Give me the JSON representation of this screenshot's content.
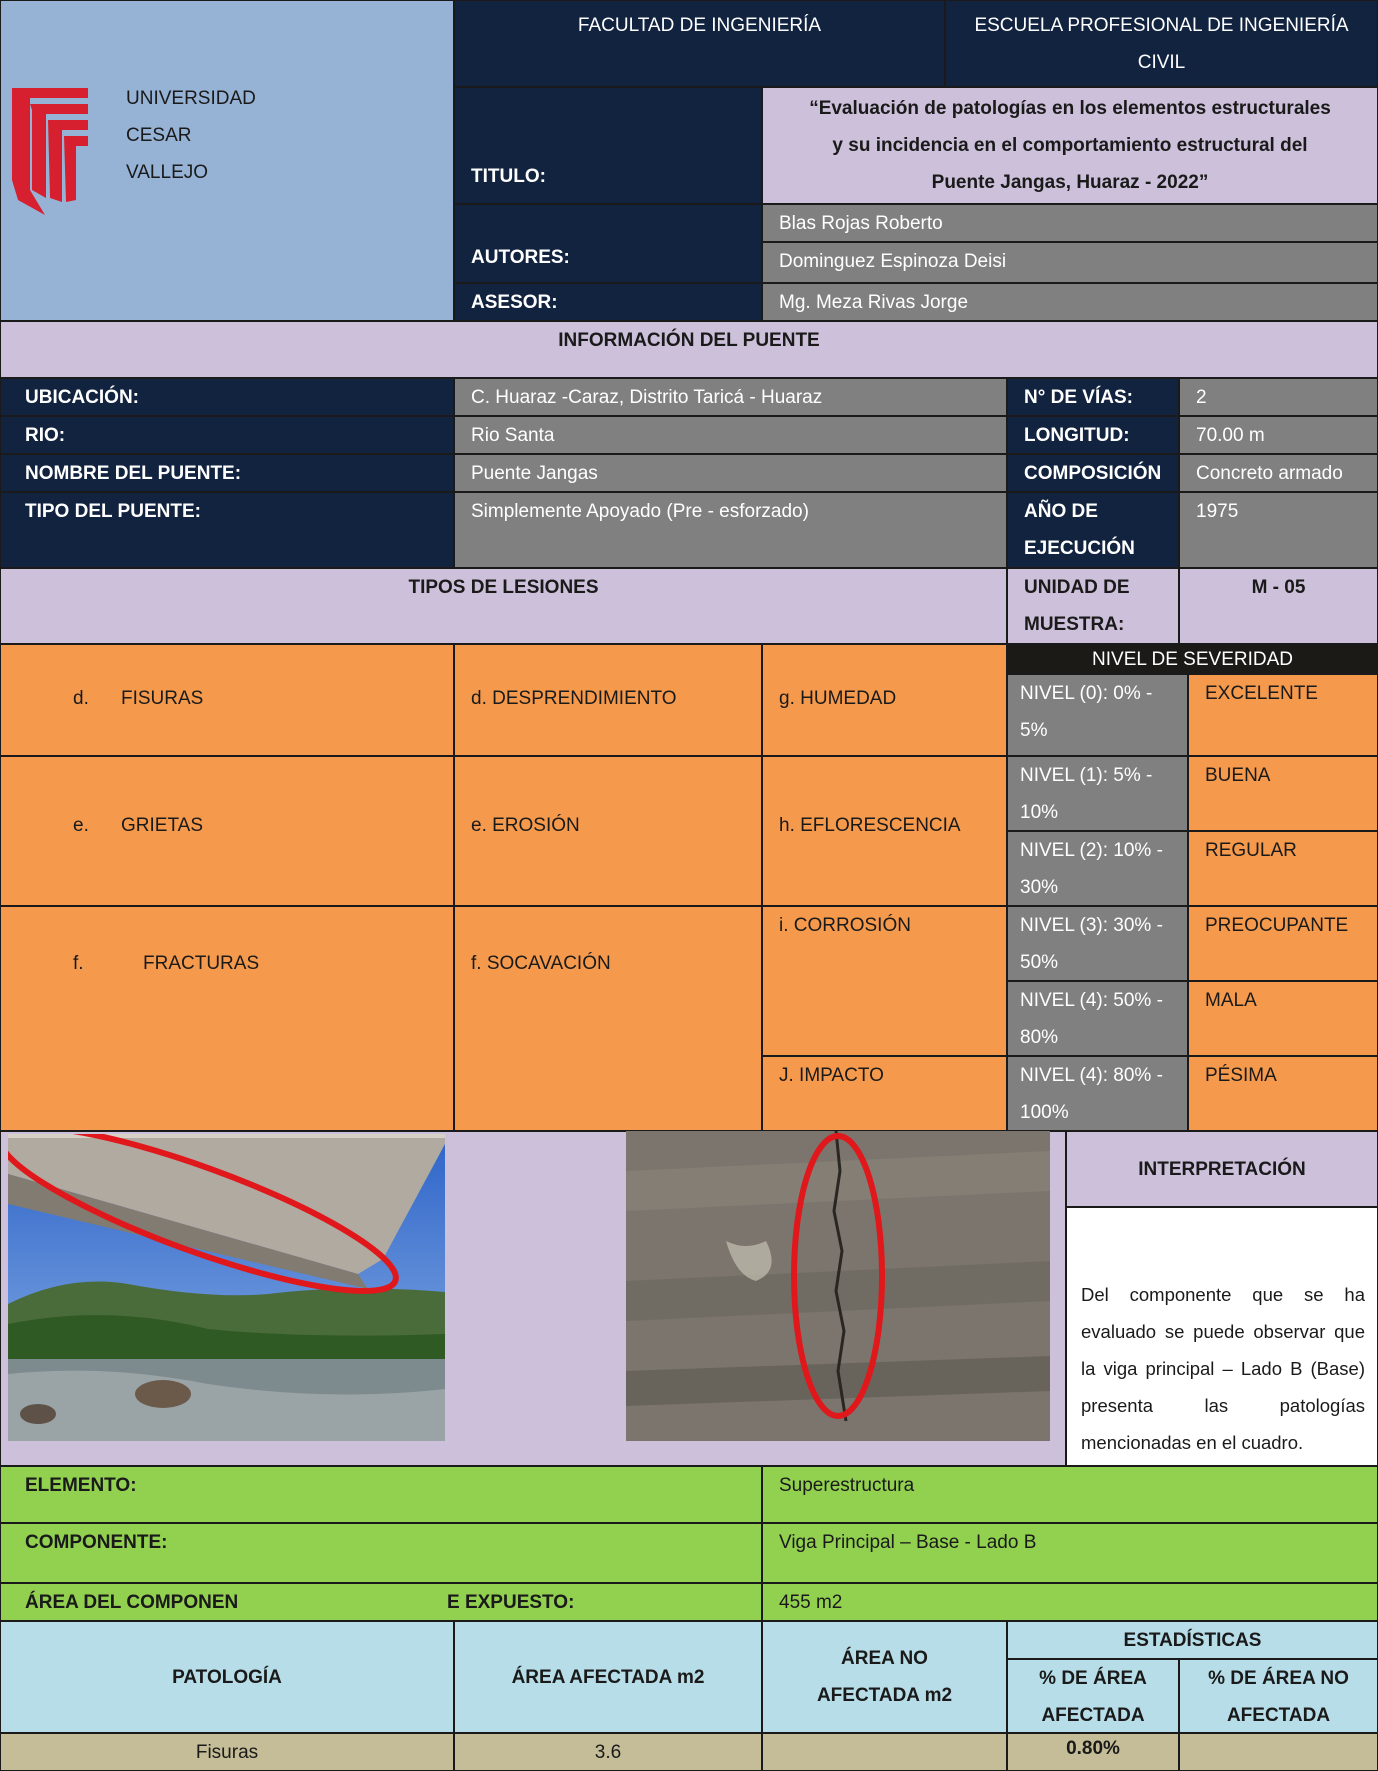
{
  "header": {
    "university": [
      "UNIVERSIDAD",
      "CESAR",
      "VALLEJO"
    ],
    "faculty": "FACULTAD DE INGENIERÍA",
    "school": "ESCUELA PROFESIONAL DE INGENIERÍA CIVIL",
    "title_label": "TITULO:",
    "title_lines": [
      "“Evaluación de patologías en los elementos estructurales",
      "y su incidencia en el comportamiento estructural del",
      "Puente Jangas, Huaraz - 2022”"
    ],
    "authors_label": "AUTORES:",
    "authors": [
      "Blas Rojas Roberto",
      "Dominguez Espinoza Deisi"
    ],
    "advisor_label": "ASESOR:",
    "advisor": "Mg. Meza Rivas Jorge"
  },
  "bridge_info": {
    "heading": "INFORMACIÓN DEL PUENTE",
    "location_label": "UBICACIÓN:",
    "location": "C. Huaraz -Caraz, Distrito Taricá - Huaraz",
    "lanes_label": "N° DE VÍAS:",
    "lanes": "2",
    "river_label": "RIO:",
    "river": "Rio Santa",
    "length_label": "LONGITUD:",
    "length": "70.00 m",
    "name_label": "NOMBRE DEL PUENTE:",
    "name": "Puente Jangas",
    "composition_label": "COMPOSICIÓN",
    "composition": "Concreto armado",
    "type_label": "TIPO DEL PUENTE:",
    "type": "Simplemente Apoyado (Pre - esforzado)",
    "year_label_1": "AÑO DE",
    "year_label_2": "EJECUCIÓN",
    "year": "1975"
  },
  "lesions": {
    "heading": "TIPOS DE LESIONES",
    "unit_label_1": "UNIDAD DE",
    "unit_label_2": "MUESTRA:",
    "unit": "M - 05",
    "col1": [
      {
        "letter": "d.",
        "name": "FISURAS"
      },
      {
        "letter": "e.",
        "name": "GRIETAS"
      },
      {
        "letter": "f.",
        "name": "FRACTURAS"
      }
    ],
    "col2": [
      "d. DESPRENDIMIENTO",
      "e. EROSIÓN",
      "f. SOCAVACIÓN"
    ],
    "col3": [
      "g. HUMEDAD",
      "h. EFLORESCENCIA",
      "i. CORROSIÓN",
      "J. IMPACTO"
    ],
    "severity_heading": "NIVEL DE SEVERIDAD",
    "severity": [
      {
        "l1": "NIVEL (0): 0% -",
        "l2": "5%",
        "rating": "EXCELENTE"
      },
      {
        "l1": "NIVEL (1): 5% -",
        "l2": "10%",
        "rating": "BUENA"
      },
      {
        "l1": "NIVEL (2): 10% -",
        "l2": "30%",
        "rating": "REGULAR"
      },
      {
        "l1": "NIVEL (3): 30% -",
        "l2": "50%",
        "rating": "PREOCUPANTE"
      },
      {
        "l1": "NIVEL (4): 50% -",
        "l2": "80%",
        "rating": "MALA"
      },
      {
        "l1": "NIVEL (4): 80% -",
        "l2": "100%",
        "rating": "PÉSIMA"
      }
    ]
  },
  "interpretation": {
    "heading": "INTERPRETACIÓN",
    "text": "Del componente que se ha evaluado se puede observar que la viga principal – Lado B (Base) presenta las patologías mencionadas en el cuadro."
  },
  "element": {
    "element_label": "ELEMENTO:",
    "element": "Superestructura",
    "component_label": "COMPONENTE:",
    "component": "Viga Principal – Base - Lado B",
    "area_label_a": "ÁREA DEL COMPONEN",
    "area_label_b": "E EXPUESTO:",
    "area": "455 m2"
  },
  "stats_table": {
    "stats_heading": "ESTADÍSTICAS",
    "headers": [
      "PATOLOGÍA",
      "ÁREA  AFECTADA m2",
      "ÁREA  NO",
      "AFECTADA m2",
      "% DE ÁREA",
      "AFECTADA",
      "% DE ÁREA NO",
      "AFECTADA"
    ],
    "rows": [
      {
        "pathology": "Fisuras",
        "affected": "3.6",
        "not_affected": "",
        "pct_affected": "0.80%",
        "pct_not": ""
      }
    ]
  },
  "colors": {
    "navy": "#12233f",
    "lavender": "#ccc0da",
    "light_blue": "#96b3d6",
    "gray": "#808080",
    "orange": "#f59a4c",
    "green": "#92d050",
    "header_blue": "#b7dde8",
    "tan": "#c4bd97",
    "logo_red": "#d7202f",
    "highlight_red": "#e0181c"
  }
}
